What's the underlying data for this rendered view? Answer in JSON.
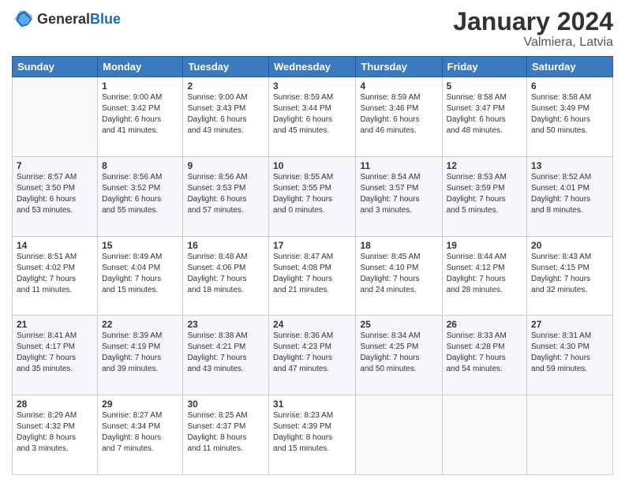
{
  "logo": {
    "general": "General",
    "blue": "Blue"
  },
  "header": {
    "month_year": "January 2024",
    "location": "Valmiera, Latvia"
  },
  "days_of_week": [
    "Sunday",
    "Monday",
    "Tuesday",
    "Wednesday",
    "Thursday",
    "Friday",
    "Saturday"
  ],
  "weeks": [
    [
      {
        "day": "",
        "info": ""
      },
      {
        "day": "1",
        "info": "Sunrise: 9:00 AM\nSunset: 3:42 PM\nDaylight: 6 hours\nand 41 minutes."
      },
      {
        "day": "2",
        "info": "Sunrise: 9:00 AM\nSunset: 3:43 PM\nDaylight: 6 hours\nand 43 minutes."
      },
      {
        "day": "3",
        "info": "Sunrise: 8:59 AM\nSunset: 3:44 PM\nDaylight: 6 hours\nand 45 minutes."
      },
      {
        "day": "4",
        "info": "Sunrise: 8:59 AM\nSunset: 3:46 PM\nDaylight: 6 hours\nand 46 minutes."
      },
      {
        "day": "5",
        "info": "Sunrise: 8:58 AM\nSunset: 3:47 PM\nDaylight: 6 hours\nand 48 minutes."
      },
      {
        "day": "6",
        "info": "Sunrise: 8:58 AM\nSunset: 3:49 PM\nDaylight: 6 hours\nand 50 minutes."
      }
    ],
    [
      {
        "day": "7",
        "info": "Sunrise: 8:57 AM\nSunset: 3:50 PM\nDaylight: 6 hours\nand 53 minutes."
      },
      {
        "day": "8",
        "info": "Sunrise: 8:56 AM\nSunset: 3:52 PM\nDaylight: 6 hours\nand 55 minutes."
      },
      {
        "day": "9",
        "info": "Sunrise: 8:56 AM\nSunset: 3:53 PM\nDaylight: 6 hours\nand 57 minutes."
      },
      {
        "day": "10",
        "info": "Sunrise: 8:55 AM\nSunset: 3:55 PM\nDaylight: 7 hours\nand 0 minutes."
      },
      {
        "day": "11",
        "info": "Sunrise: 8:54 AM\nSunset: 3:57 PM\nDaylight: 7 hours\nand 3 minutes."
      },
      {
        "day": "12",
        "info": "Sunrise: 8:53 AM\nSunset: 3:59 PM\nDaylight: 7 hours\nand 5 minutes."
      },
      {
        "day": "13",
        "info": "Sunrise: 8:52 AM\nSunset: 4:01 PM\nDaylight: 7 hours\nand 8 minutes."
      }
    ],
    [
      {
        "day": "14",
        "info": "Sunrise: 8:51 AM\nSunset: 4:02 PM\nDaylight: 7 hours\nand 11 minutes."
      },
      {
        "day": "15",
        "info": "Sunrise: 8:49 AM\nSunset: 4:04 PM\nDaylight: 7 hours\nand 15 minutes."
      },
      {
        "day": "16",
        "info": "Sunrise: 8:48 AM\nSunset: 4:06 PM\nDaylight: 7 hours\nand 18 minutes."
      },
      {
        "day": "17",
        "info": "Sunrise: 8:47 AM\nSunset: 4:08 PM\nDaylight: 7 hours\nand 21 minutes."
      },
      {
        "day": "18",
        "info": "Sunrise: 8:45 AM\nSunset: 4:10 PM\nDaylight: 7 hours\nand 24 minutes."
      },
      {
        "day": "19",
        "info": "Sunrise: 8:44 AM\nSunset: 4:12 PM\nDaylight: 7 hours\nand 28 minutes."
      },
      {
        "day": "20",
        "info": "Sunrise: 8:43 AM\nSunset: 4:15 PM\nDaylight: 7 hours\nand 32 minutes."
      }
    ],
    [
      {
        "day": "21",
        "info": "Sunrise: 8:41 AM\nSunset: 4:17 PM\nDaylight: 7 hours\nand 35 minutes."
      },
      {
        "day": "22",
        "info": "Sunrise: 8:39 AM\nSunset: 4:19 PM\nDaylight: 7 hours\nand 39 minutes."
      },
      {
        "day": "23",
        "info": "Sunrise: 8:38 AM\nSunset: 4:21 PM\nDaylight: 7 hours\nand 43 minutes."
      },
      {
        "day": "24",
        "info": "Sunrise: 8:36 AM\nSunset: 4:23 PM\nDaylight: 7 hours\nand 47 minutes."
      },
      {
        "day": "25",
        "info": "Sunrise: 8:34 AM\nSunset: 4:25 PM\nDaylight: 7 hours\nand 50 minutes."
      },
      {
        "day": "26",
        "info": "Sunrise: 8:33 AM\nSunset: 4:28 PM\nDaylight: 7 hours\nand 54 minutes."
      },
      {
        "day": "27",
        "info": "Sunrise: 8:31 AM\nSunset: 4:30 PM\nDaylight: 7 hours\nand 59 minutes."
      }
    ],
    [
      {
        "day": "28",
        "info": "Sunrise: 8:29 AM\nSunset: 4:32 PM\nDaylight: 8 hours\nand 3 minutes."
      },
      {
        "day": "29",
        "info": "Sunrise: 8:27 AM\nSunset: 4:34 PM\nDaylight: 8 hours\nand 7 minutes."
      },
      {
        "day": "30",
        "info": "Sunrise: 8:25 AM\nSunset: 4:37 PM\nDaylight: 8 hours\nand 11 minutes."
      },
      {
        "day": "31",
        "info": "Sunrise: 8:23 AM\nSunset: 4:39 PM\nDaylight: 8 hours\nand 15 minutes."
      },
      {
        "day": "",
        "info": ""
      },
      {
        "day": "",
        "info": ""
      },
      {
        "day": "",
        "info": ""
      }
    ]
  ]
}
